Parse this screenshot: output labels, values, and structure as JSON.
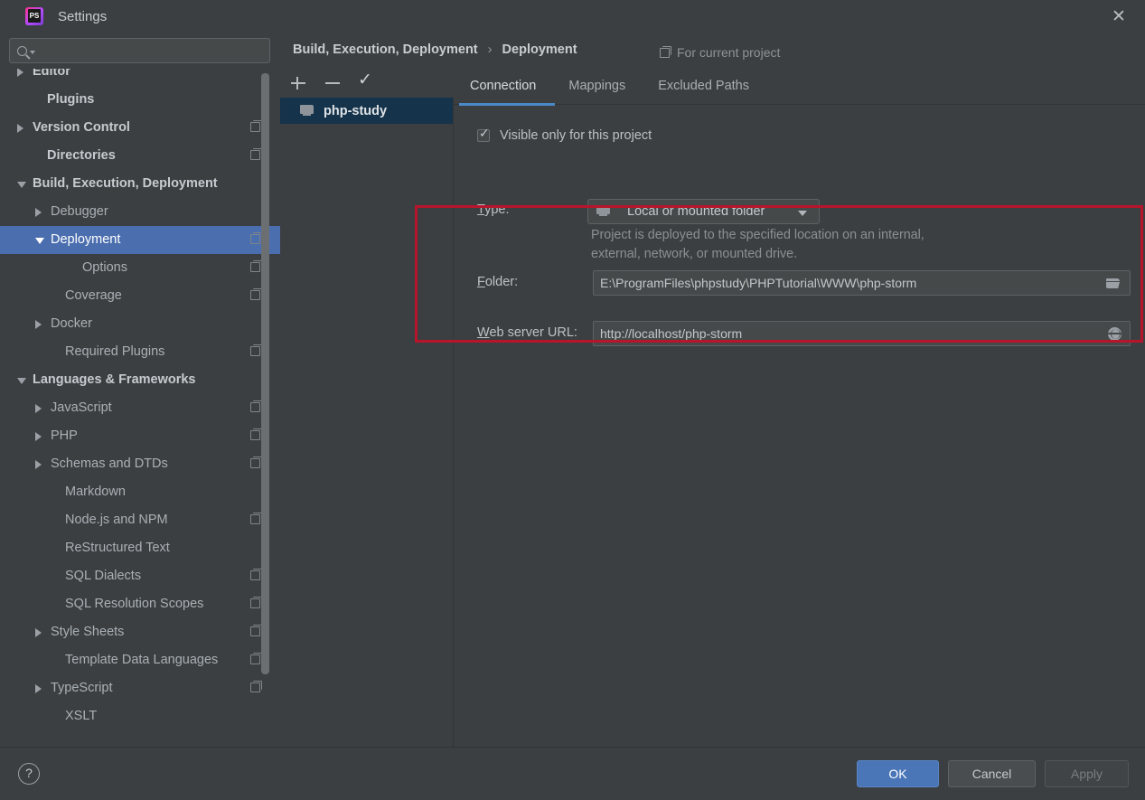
{
  "window": {
    "title": "Settings",
    "logo_icon": "phpstorm-logo-icon",
    "close_icon": "close-icon"
  },
  "search": {
    "value": "",
    "placeholder": "",
    "icon": "search-icon",
    "dropdown_icon": "chevron-down-icon"
  },
  "sidebar": {
    "items": [
      {
        "label": "Editor",
        "arrow": "collapsed",
        "indent": 20,
        "bold": true,
        "copy": false,
        "selected": false
      },
      {
        "label": "Plugins",
        "arrow": "none",
        "indent": 36,
        "bold": true,
        "copy": false,
        "selected": false
      },
      {
        "label": "Version Control",
        "arrow": "collapsed",
        "indent": 20,
        "bold": true,
        "copy": true,
        "selected": false
      },
      {
        "label": "Directories",
        "arrow": "none",
        "indent": 36,
        "bold": true,
        "copy": true,
        "selected": false
      },
      {
        "label": "Build, Execution, Deployment",
        "arrow": "expanded",
        "indent": 20,
        "bold": true,
        "copy": false,
        "selected": false
      },
      {
        "label": "Debugger",
        "arrow": "collapsed",
        "indent": 40,
        "bold": false,
        "copy": false,
        "selected": false
      },
      {
        "label": "Deployment",
        "arrow": "expanded",
        "indent": 40,
        "bold": false,
        "copy": true,
        "selected": true
      },
      {
        "label": "Options",
        "arrow": "none",
        "indent": 75,
        "bold": false,
        "copy": true,
        "selected": false
      },
      {
        "label": "Coverage",
        "arrow": "none",
        "indent": 56,
        "bold": false,
        "copy": true,
        "selected": false
      },
      {
        "label": "Docker",
        "arrow": "collapsed",
        "indent": 40,
        "bold": false,
        "copy": false,
        "selected": false
      },
      {
        "label": "Required Plugins",
        "arrow": "none",
        "indent": 56,
        "bold": false,
        "copy": true,
        "selected": false
      },
      {
        "label": "Languages & Frameworks",
        "arrow": "expanded",
        "indent": 20,
        "bold": true,
        "copy": false,
        "selected": false
      },
      {
        "label": "JavaScript",
        "arrow": "collapsed",
        "indent": 40,
        "bold": false,
        "copy": true,
        "selected": false
      },
      {
        "label": "PHP",
        "arrow": "collapsed",
        "indent": 40,
        "bold": false,
        "copy": true,
        "selected": false
      },
      {
        "label": "Schemas and DTDs",
        "arrow": "collapsed",
        "indent": 40,
        "bold": false,
        "copy": true,
        "selected": false
      },
      {
        "label": "Markdown",
        "arrow": "none",
        "indent": 56,
        "bold": false,
        "copy": false,
        "selected": false
      },
      {
        "label": "Node.js and NPM",
        "arrow": "none",
        "indent": 56,
        "bold": false,
        "copy": true,
        "selected": false
      },
      {
        "label": "ReStructured Text",
        "arrow": "none",
        "indent": 56,
        "bold": false,
        "copy": false,
        "selected": false
      },
      {
        "label": "SQL Dialects",
        "arrow": "none",
        "indent": 56,
        "bold": false,
        "copy": true,
        "selected": false
      },
      {
        "label": "SQL Resolution Scopes",
        "arrow": "none",
        "indent": 56,
        "bold": false,
        "copy": true,
        "selected": false
      },
      {
        "label": "Style Sheets",
        "arrow": "collapsed",
        "indent": 40,
        "bold": false,
        "copy": true,
        "selected": false
      },
      {
        "label": "Template Data Languages",
        "arrow": "none",
        "indent": 56,
        "bold": false,
        "copy": true,
        "selected": false
      },
      {
        "label": "TypeScript",
        "arrow": "collapsed",
        "indent": 40,
        "bold": false,
        "copy": true,
        "selected": false
      },
      {
        "label": "XSLT",
        "arrow": "none",
        "indent": 56,
        "bold": false,
        "copy": false,
        "selected": false
      }
    ]
  },
  "breadcrumb": {
    "parent": "Build, Execution, Deployment",
    "separator": "›",
    "current": "Deployment"
  },
  "scope_note": {
    "label": "For current project",
    "icon": "copy-icon"
  },
  "toolbar": {
    "add_icon": "plus-icon",
    "remove_icon": "minus-icon",
    "default_icon": "check-icon"
  },
  "server_list": {
    "items": [
      {
        "label": "php-study",
        "icon": "local-folder-icon",
        "selected": true
      }
    ]
  },
  "tabs": [
    {
      "label": "Connection",
      "active": true
    },
    {
      "label": "Mappings",
      "active": false
    },
    {
      "label": "Excluded Paths",
      "active": false
    }
  ],
  "form": {
    "visible_only_checkbox": {
      "label": "Visible only for this project",
      "checked": true
    },
    "type": {
      "label": "Type:",
      "mnemonic": "T",
      "value": "Local or mounted folder",
      "icon": "local-folder-icon",
      "dropdown_icon": "chevron-down-icon",
      "help_line1": "Project is deployed to the specified location on an internal,",
      "help_line2": "external, network, or mounted drive."
    },
    "folder": {
      "label": "Folder:",
      "mnemonic": "F",
      "value": "E:\\ProgramFiles\\phpstudy\\PHPTutorial\\WWW\\php-storm",
      "browse_icon": "folder-icon"
    },
    "web_server_url": {
      "label": "Web server URL:",
      "mnemonic": "W",
      "value": "http://localhost/php-storm",
      "open_icon": "globe-icon"
    }
  },
  "annotation": {
    "color": "#b7152c"
  },
  "footer": {
    "help_icon": "help-icon",
    "help_label": "?",
    "ok_label": "OK",
    "cancel_label": "Cancel",
    "apply_label": "Apply",
    "apply_enabled": false
  },
  "colors": {
    "background": "#3c3f41",
    "selection_blue": "#4b6eaf",
    "tab_accent": "#4a88c7",
    "list_selection": "#15334a",
    "annotation_red": "#b7152c"
  }
}
